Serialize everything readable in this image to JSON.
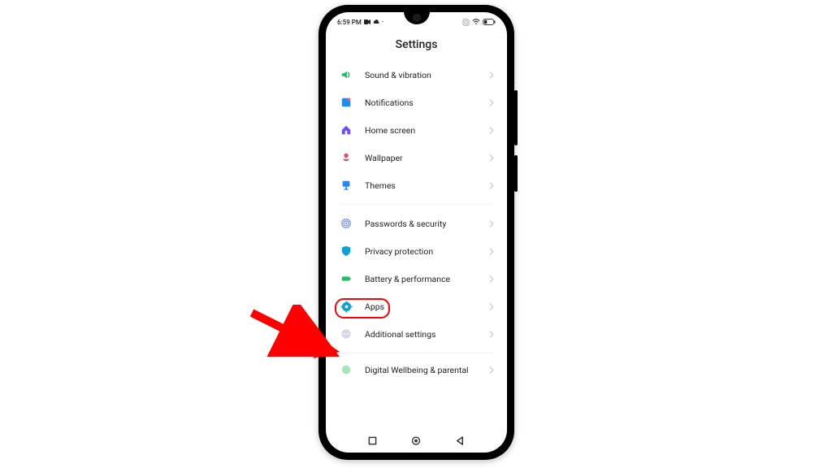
{
  "status": {
    "time": "6:59 PM"
  },
  "page": {
    "title": "Settings"
  },
  "groups": [
    {
      "items": [
        {
          "key": "sound",
          "label": "Sound & vibration",
          "icon_color": "#1fbf5f"
        },
        {
          "key": "notifications",
          "label": "Notifications",
          "icon_color": "#1a8cff"
        },
        {
          "key": "home",
          "label": "Home screen",
          "icon_color": "#6a4cff"
        },
        {
          "key": "wallpaper",
          "label": "Wallpaper",
          "icon_color": "#e64a6a"
        },
        {
          "key": "themes",
          "label": "Themes",
          "icon_color": "#1a8cff"
        }
      ]
    },
    {
      "items": [
        {
          "key": "passwords",
          "label": "Passwords & security",
          "icon_color": "#5a7cff"
        },
        {
          "key": "privacy",
          "label": "Privacy protection",
          "icon_color": "#0d9fd8"
        },
        {
          "key": "battery",
          "label": "Battery & performance",
          "icon_color": "#1fbf5f"
        },
        {
          "key": "apps",
          "label": "Apps",
          "icon_color": "#0d9fd8",
          "highlighted": true
        },
        {
          "key": "additional",
          "label": "Additional settings",
          "icon_color": "#b8b8c4"
        }
      ]
    },
    {
      "items": [
        {
          "key": "wellbeing",
          "label": "Digital Wellbeing & parental",
          "icon_color": "#1fbf5f"
        }
      ]
    }
  ],
  "highlight": {
    "arrow_color": "#ff0000",
    "ring_color": "#ff0000"
  }
}
